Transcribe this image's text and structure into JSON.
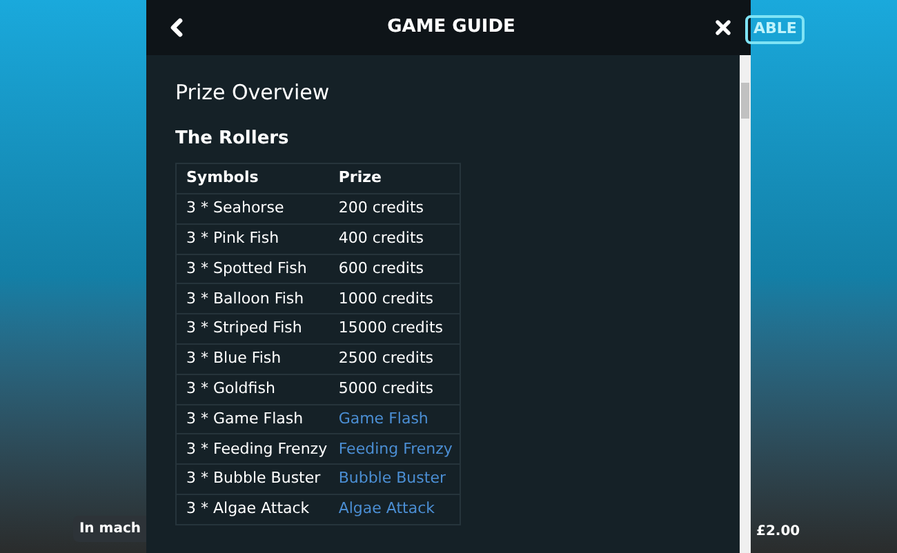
{
  "background": {
    "badge": "ABLE",
    "balance_label": "In mach",
    "bet_value": "£2.00"
  },
  "dialog": {
    "title": "GAME GUIDE",
    "section_title": "Prize Overview",
    "subsection_title": "The Rollers",
    "table": {
      "columns": [
        "Symbols",
        "Prize"
      ],
      "rows": [
        {
          "symbol": "3 * Seahorse",
          "prize": "200 credits",
          "kind": "text"
        },
        {
          "symbol": "3 * Pink Fish",
          "prize": "400 credits",
          "kind": "text"
        },
        {
          "symbol": "3 * Spotted Fish",
          "prize": "600 credits",
          "kind": "text"
        },
        {
          "symbol": "3 * Balloon Fish",
          "prize": "1000 credits",
          "kind": "text"
        },
        {
          "symbol": "3 * Striped Fish",
          "prize": "15000 credits",
          "kind": "text"
        },
        {
          "symbol": "3 * Blue Fish",
          "prize": "2500 credits",
          "kind": "text"
        },
        {
          "symbol": "3 * Goldfish",
          "prize": "5000 credits",
          "kind": "text"
        },
        {
          "symbol": "3 * Game Flash",
          "prize": "Game Flash",
          "kind": "link"
        },
        {
          "symbol": "3 * Feeding Frenzy",
          "prize": "Feeding Frenzy",
          "kind": "link"
        },
        {
          "symbol": "3 * Bubble Buster",
          "prize": "Bubble Buster",
          "kind": "link"
        },
        {
          "symbol": "3 * Algae Attack",
          "prize": "Algae Attack",
          "kind": "link"
        }
      ]
    }
  }
}
